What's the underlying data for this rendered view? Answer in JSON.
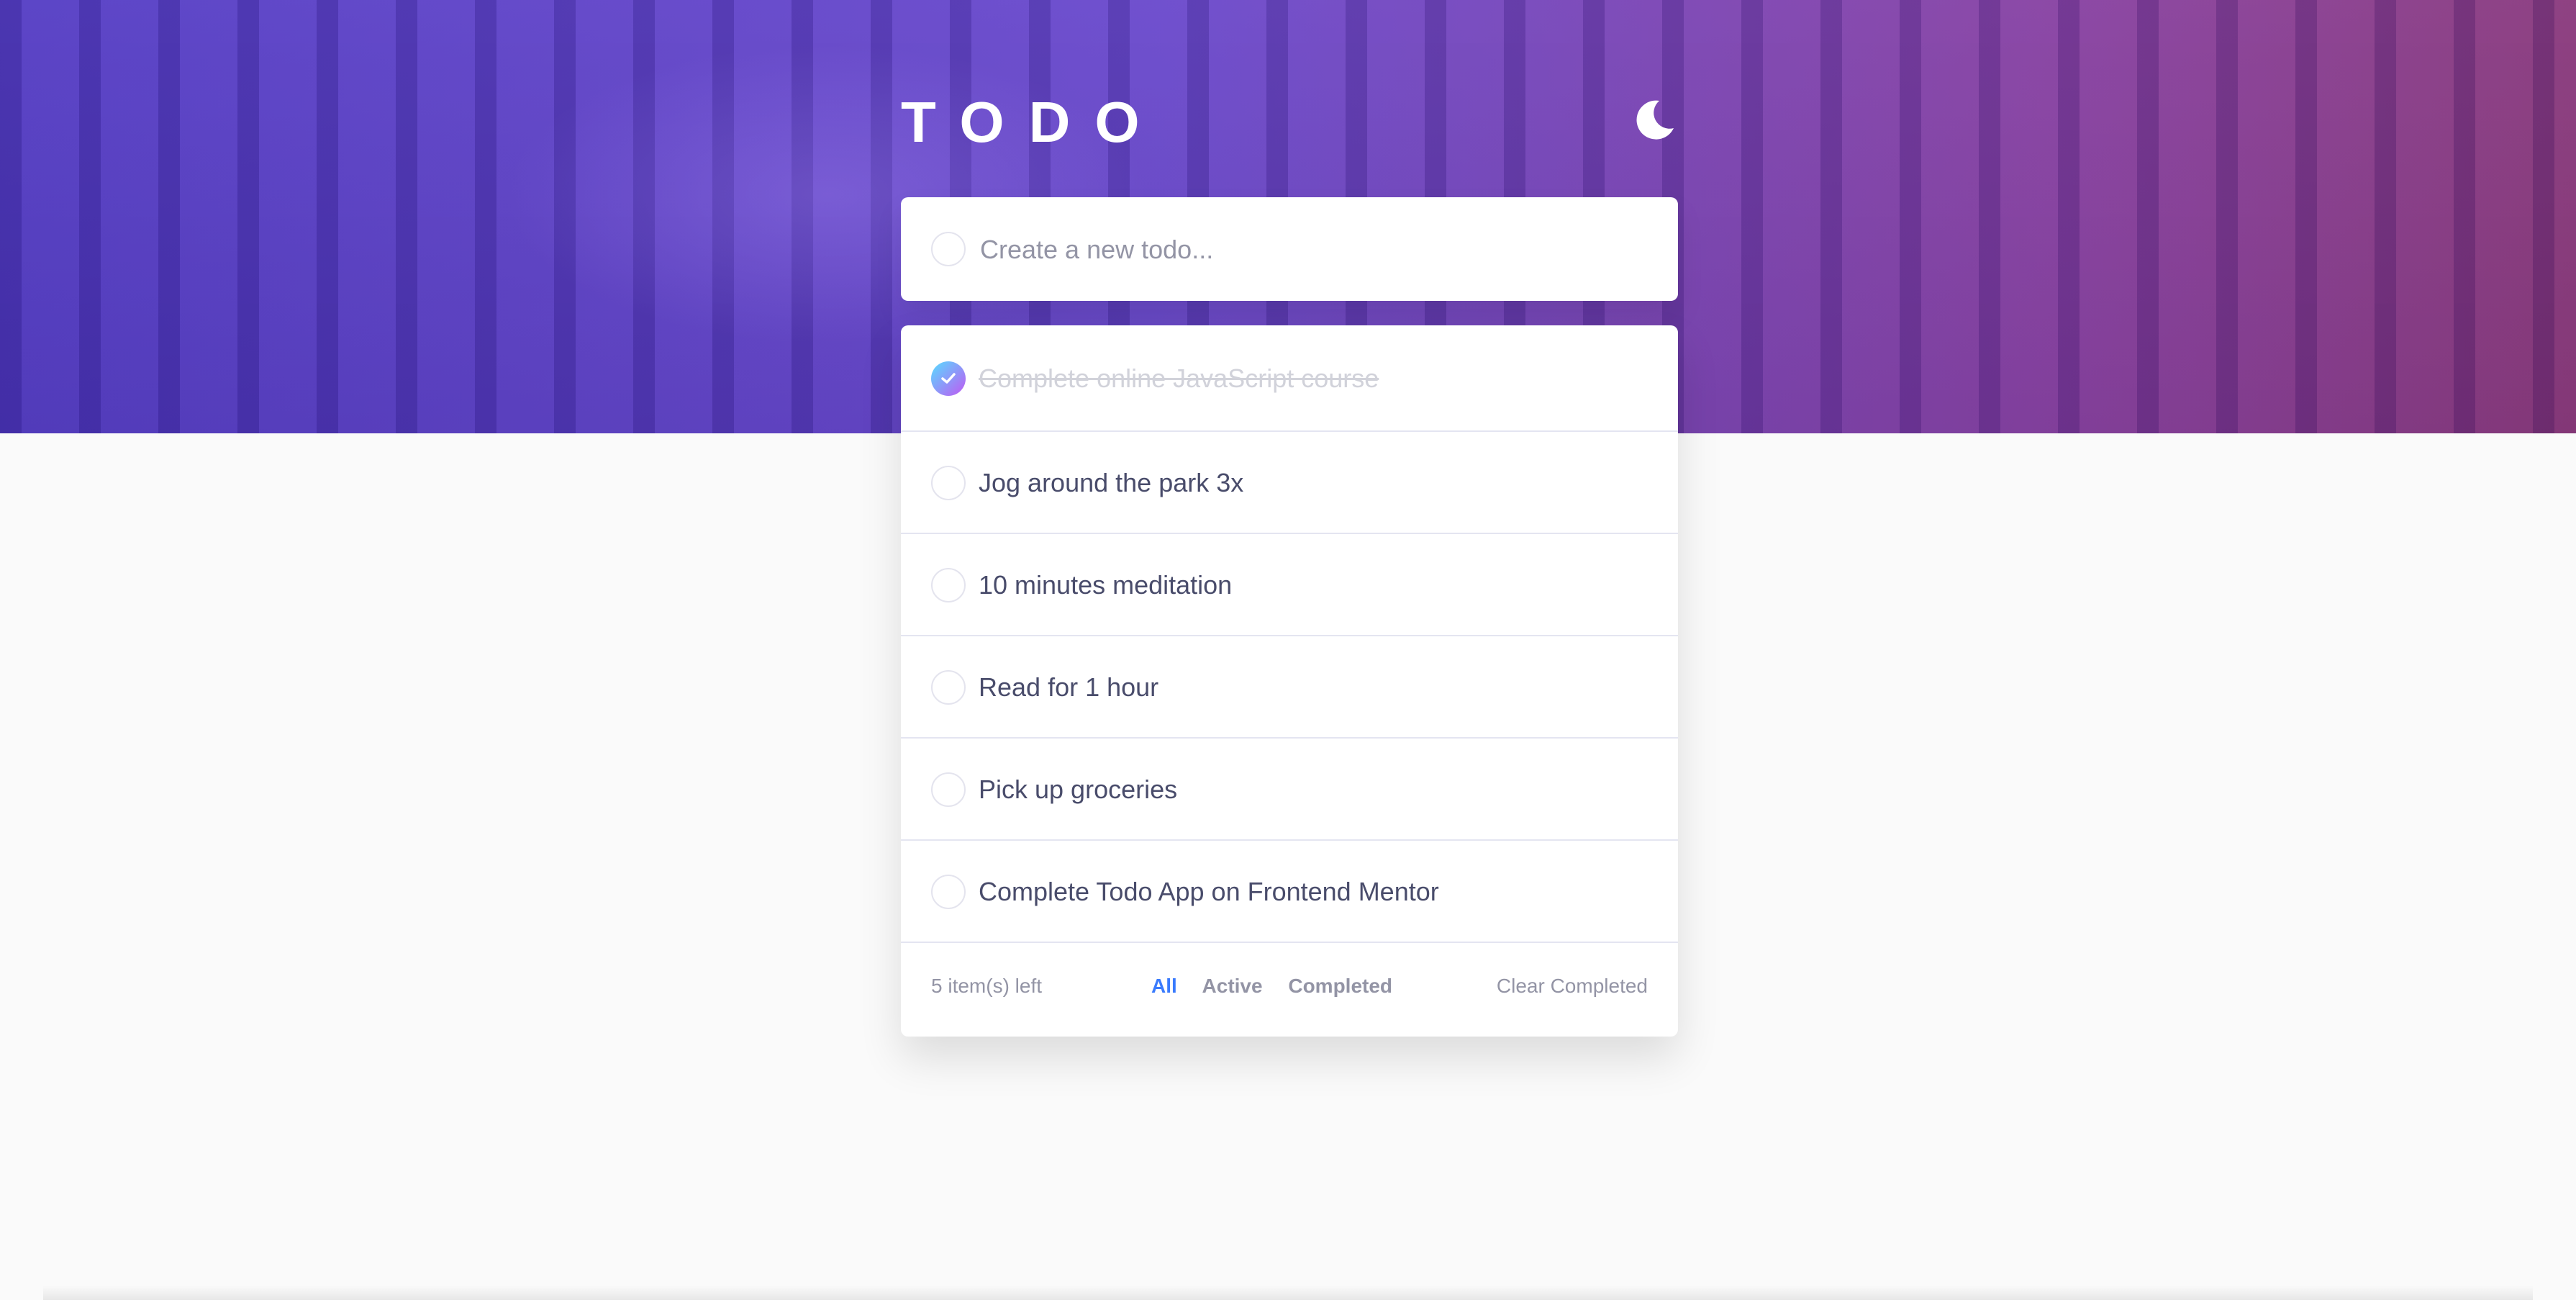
{
  "app": {
    "title": "TODO",
    "theme_icon": "moon-icon",
    "accent_color": "#3a7bfd",
    "check_gradient": [
      "#57ddff",
      "#c058f3"
    ]
  },
  "new_todo": {
    "placeholder": "Create a new todo..."
  },
  "todos": [
    {
      "text": "Complete online JavaScript course",
      "completed": true
    },
    {
      "text": "Jog around the park 3x",
      "completed": false
    },
    {
      "text": "10 minutes meditation",
      "completed": false
    },
    {
      "text": "Read for 1 hour",
      "completed": false
    },
    {
      "text": "Pick up groceries",
      "completed": false
    },
    {
      "text": "Complete Todo App on Frontend Mentor",
      "completed": false
    }
  ],
  "footer": {
    "items_left": "5 item(s) left",
    "filters": {
      "all": "All",
      "active": "Active",
      "completed": "Completed"
    },
    "active_filter": "All",
    "clear_label": "Clear Completed"
  }
}
